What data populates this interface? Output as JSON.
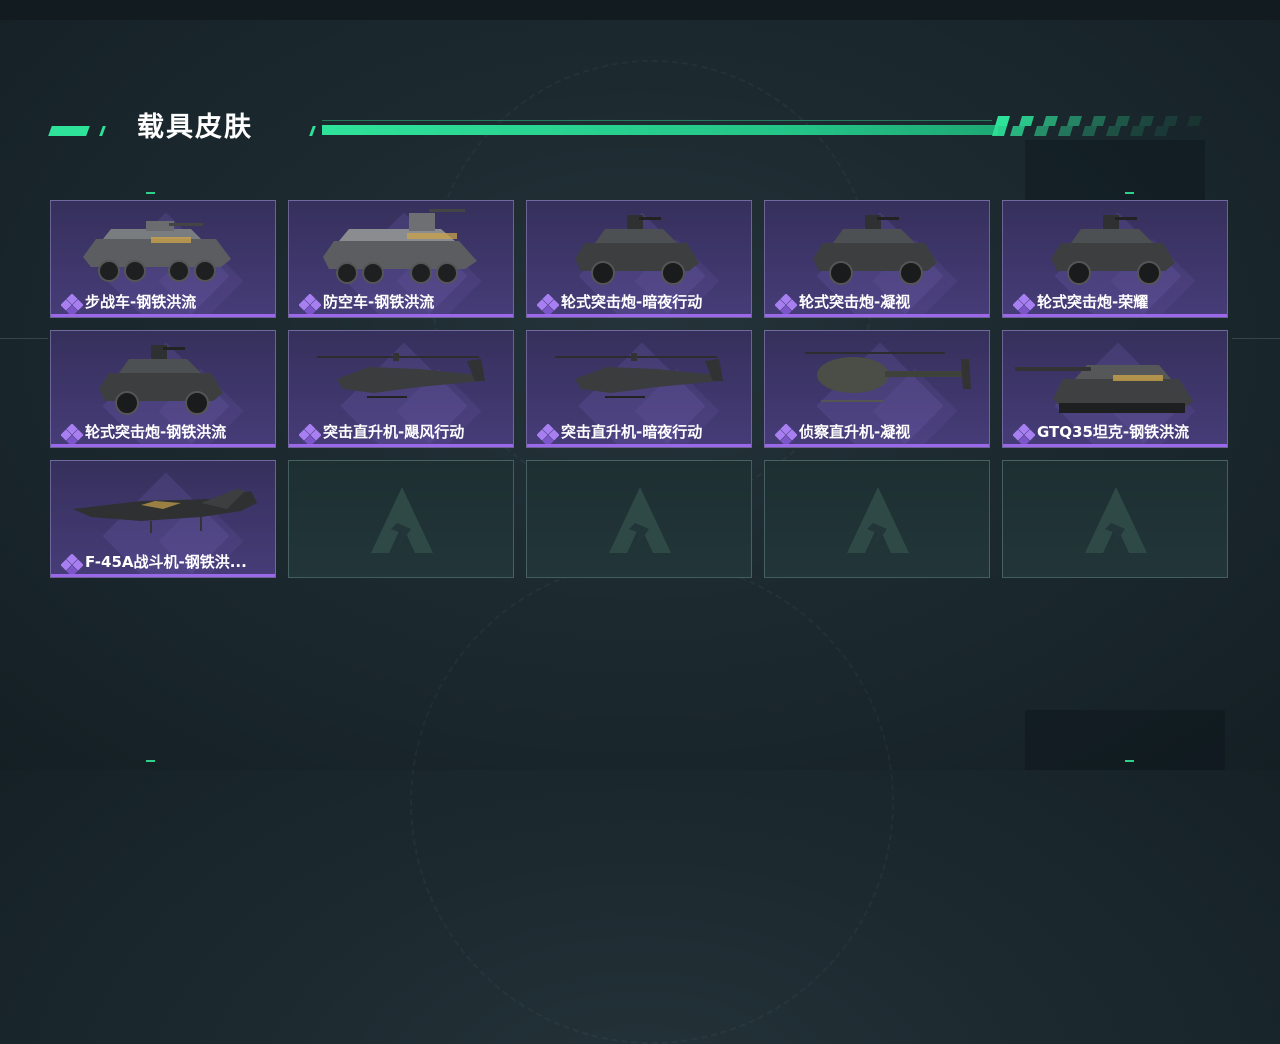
{
  "section": {
    "title": "载具皮肤"
  },
  "colors": {
    "accent": "#2fe29a",
    "card_rarity": "#9a68e8",
    "card_bg": "#3e3569"
  },
  "skins": [
    {
      "label": "步战车-钢铁洪流",
      "vehicle": "ifv-8wheel-icon"
    },
    {
      "label": "防空车-钢铁洪流",
      "vehicle": "aa-vehicle-icon"
    },
    {
      "label": "轮式突击炮-暗夜行动",
      "vehicle": "armored-car-icon"
    },
    {
      "label": "轮式突击炮-凝视",
      "vehicle": "armored-car-icon"
    },
    {
      "label": "轮式突击炮-荣耀",
      "vehicle": "armored-car-icon"
    },
    {
      "label": "轮式突击炮-钢铁洪流",
      "vehicle": "armored-car-icon"
    },
    {
      "label": "突击直升机-飓风行动",
      "vehicle": "attack-helicopter-icon"
    },
    {
      "label": "突击直升机-暗夜行动",
      "vehicle": "attack-helicopter-icon"
    },
    {
      "label": "侦察直升机-凝视",
      "vehicle": "scout-helicopter-icon"
    },
    {
      "label": "GTQ35坦克-钢铁洪流",
      "vehicle": "tank-icon"
    },
    {
      "label": "F-45A战斗机-钢铁洪...",
      "vehicle": "fighter-jet-icon"
    }
  ],
  "empty_slots": 4
}
